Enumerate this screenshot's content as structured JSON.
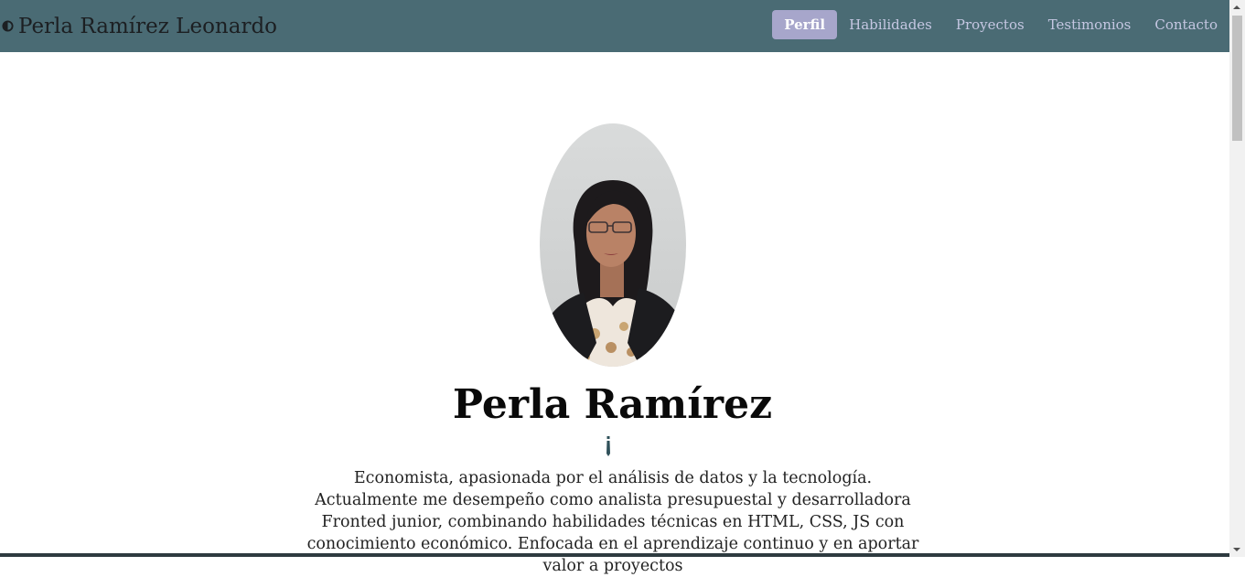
{
  "navbar": {
    "brand_icon": "half-circle-logo-icon",
    "brand_name": "Perla Ramírez Leonardo",
    "links": [
      {
        "label": "Perfil",
        "active": true
      },
      {
        "label": "Habilidades",
        "active": false
      },
      {
        "label": "Proyectos",
        "active": false
      },
      {
        "label": "Testimonios",
        "active": false
      },
      {
        "label": "Contacto",
        "active": false
      }
    ],
    "colors": {
      "background": "#4a6b74",
      "active_background": "#a7a6cb",
      "link": "#c5c7e2"
    }
  },
  "profile": {
    "photo_icon": "profile-photo",
    "name": "Perla Ramírez",
    "icon": "tie-icon",
    "bio": "Economista, apasionada por el análisis de datos y la tecnología. Actualmente me desempeño como analista presupuestal y desarrolladora Fronted junior, combinando habilidades técnicas en HTML, CSS, JS con conocimiento económico. Enfocada en el aprendizaje continuo y en aportar valor a proyectos"
  }
}
